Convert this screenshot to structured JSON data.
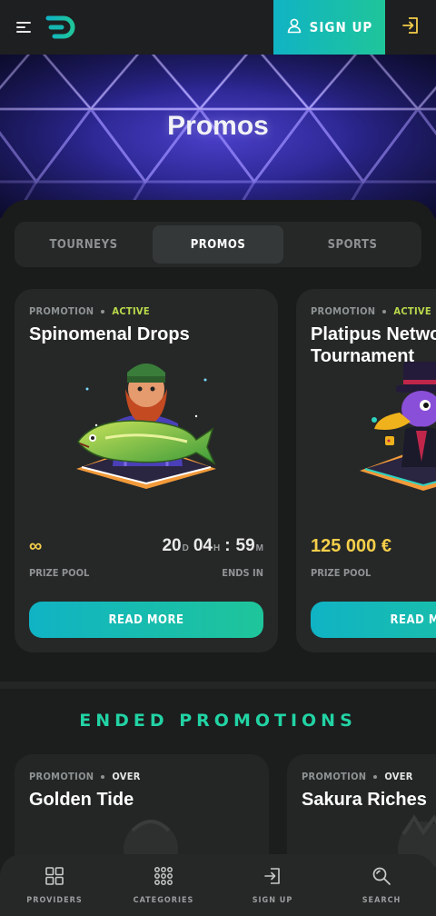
{
  "header": {
    "signup_label": "SIGN UP",
    "menu_icon": "menu-icon",
    "logo_icon": "logo-icon",
    "login_icon": "login-icon",
    "accent_gradient": [
      "#10b3c4",
      "#1fc59a"
    ],
    "login_color": "#f5cf4a"
  },
  "hero": {
    "title": "Promos"
  },
  "tabs": [
    {
      "label": "TOURNEYS",
      "active": false
    },
    {
      "label": "PROMOS",
      "active": true
    },
    {
      "label": "SPORTS",
      "active": false
    }
  ],
  "promos": [
    {
      "kind": "PROMOTION",
      "status": "ACTIVE",
      "title": "Spinomenal Drops",
      "prize_value": "∞",
      "prize_label": "PRIZE POOL",
      "timer": {
        "days": "20",
        "days_unit": "D",
        "hours": "04",
        "hours_unit": "H",
        "sep": ":",
        "minutes": "59",
        "minutes_unit": "M"
      },
      "ends_label": "ENDS IN",
      "button": "READ MORE"
    },
    {
      "kind": "PROMOTION",
      "status": "ACTIVE",
      "title": "Platipus Network Tournament",
      "prize_value": "125 000 €",
      "prize_label": "PRIZE POOL",
      "button": "READ MORE"
    }
  ],
  "ended": {
    "title": "ENDED PROMOTIONS",
    "items": [
      {
        "kind": "PROMOTION",
        "status": "OVER",
        "title": "Golden Tide"
      },
      {
        "kind": "PROMOTION",
        "status": "OVER",
        "title": "Sakura Riches"
      }
    ]
  },
  "bottom_nav": [
    {
      "label": "PROVIDERS",
      "icon": "grid-icon"
    },
    {
      "label": "CATEGORIES",
      "icon": "dots-grid-icon"
    },
    {
      "label": "SIGN UP",
      "icon": "login-icon"
    },
    {
      "label": "SEARCH",
      "icon": "search-icon"
    }
  ]
}
